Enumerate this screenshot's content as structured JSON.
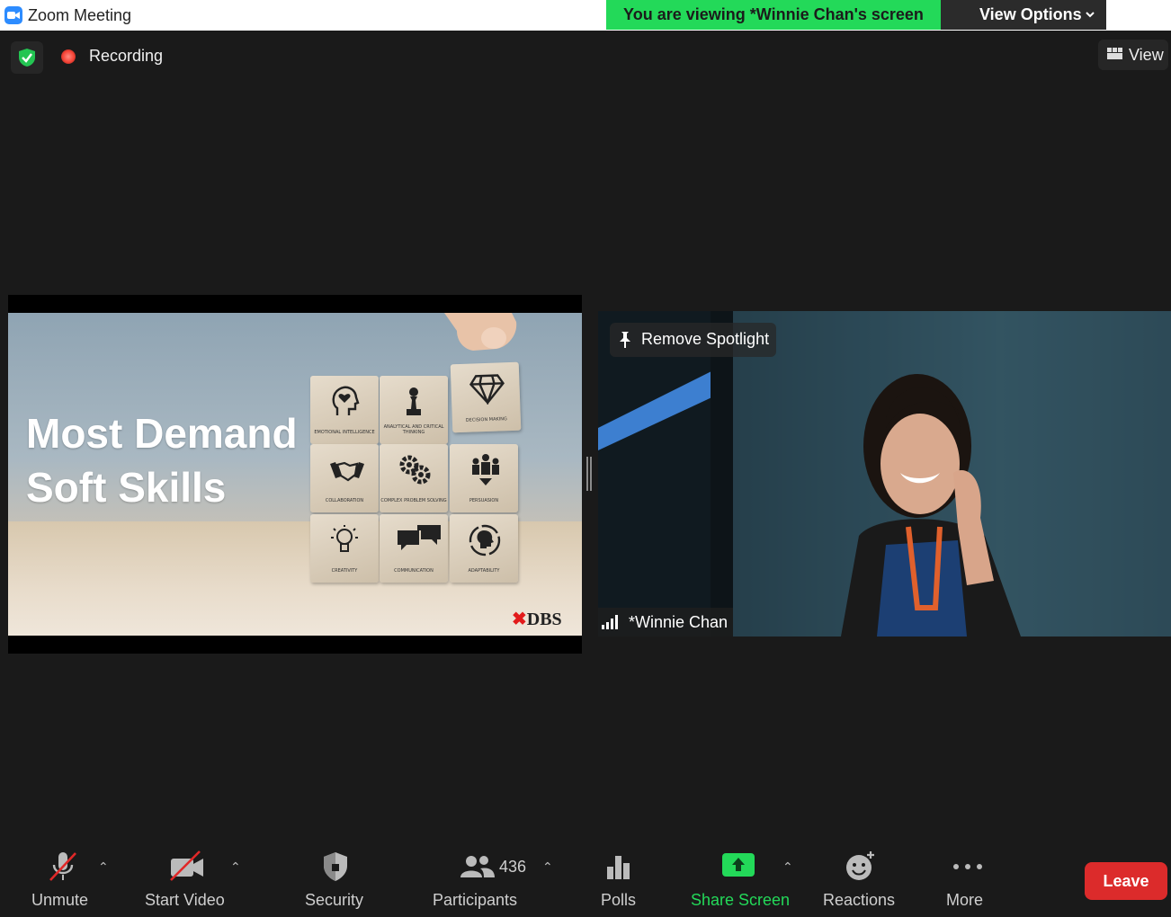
{
  "window": {
    "title": "Zoom Meeting"
  },
  "banner": {
    "text": "You are viewing *Winnie Chan's screen",
    "view_options": "View Options"
  },
  "overlay": {
    "recording": "Recording",
    "view": "View"
  },
  "slide": {
    "title_line1": "Most Demand",
    "title_line2": "Soft Skills",
    "blocks": [
      {
        "icon": "head-heart-icon",
        "caption": "EMOTIONAL INTELLIGENCE"
      },
      {
        "icon": "chess-pawn-icon",
        "caption": "ANALYTICAL AND CRITICAL THINKING"
      },
      {
        "icon": "diamond-icon",
        "caption": "DECISION MAKING"
      },
      {
        "icon": "handshake-icon",
        "caption": "COLLABORATION"
      },
      {
        "icon": "gears-icon",
        "caption": "COMPLEX PROBLEM SOLVING"
      },
      {
        "icon": "people-icon",
        "caption": "PERSUASION"
      },
      {
        "icon": "lightbulb-icon",
        "caption": "CREATIVITY"
      },
      {
        "icon": "chat-bubbles-icon",
        "caption": "COMMUNICATION"
      },
      {
        "icon": "adaptability-icon",
        "caption": "ADAPTABILITY"
      }
    ],
    "logo": "DBS"
  },
  "video": {
    "spotlight": "Remove Spotlight",
    "participant_name": "*Winnie Chan"
  },
  "toolbar": {
    "unmute": "Unmute",
    "start_video": "Start Video",
    "security": "Security",
    "participants": "Participants",
    "participant_count": "436",
    "polls": "Polls",
    "share_screen": "Share Screen",
    "reactions": "Reactions",
    "more": "More",
    "leave": "Leave"
  },
  "colors": {
    "share_green": "#23d959",
    "leave_red": "#dc2b2b",
    "accent_blue": "#2d8cff",
    "bg": "#1a1a1a"
  }
}
